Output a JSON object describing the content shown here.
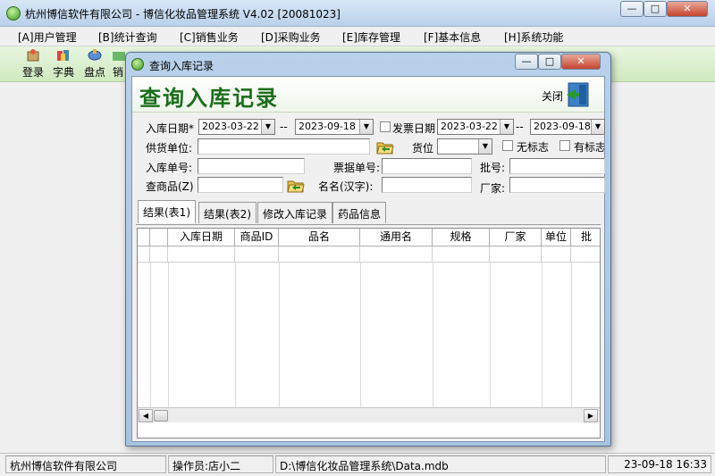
{
  "window": {
    "title": "杭州博信软件有限公司 - 博信化妆品管理系统 V4.02 [20081023]",
    "min_glyph": "—",
    "max_glyph": "□",
    "close_glyph": "✕"
  },
  "menu": [
    "[A]用户管理",
    "[B]统计查询",
    "[C]销售业务",
    "[D]采购业务",
    "[E]库存管理",
    "[F]基本信息",
    "[H]系统功能"
  ],
  "toolbar": [
    {
      "label": "登录",
      "icon": "login-icon"
    },
    {
      "label": "字典",
      "icon": "dictionary-icon"
    },
    {
      "label": "盘点",
      "icon": "inventory-icon"
    },
    {
      "label": "销",
      "icon": "sales-icon"
    }
  ],
  "dialog": {
    "title": "查询入库记录",
    "banner": "查询入库记录",
    "close_label": "关闭",
    "min_glyph": "—",
    "max_glyph": "□",
    "close_glyph": "✕",
    "form": {
      "inbound_date_label": "入库日期*",
      "inbound_date_from": "2023-03-22",
      "inbound_date_to": "2023-09-18",
      "range_sep": "--",
      "invoice_date_label": "发票日期",
      "invoice_date_from": "2023-03-22",
      "invoice_date_to": "2023-09-18",
      "supplier_label": "供货单位:",
      "supplier_value": "",
      "location_label": "货位",
      "location_value": "",
      "no_mark_label": "无标志",
      "has_mark_label": "有标志",
      "inbound_no_label": "入库单号:",
      "inbound_no_value": "",
      "ticket_no_label": "票据单号:",
      "ticket_no_value": "",
      "batch_no_label": "批号:",
      "batch_no_value": "",
      "product_search_label": "查商品(Z)",
      "product_search_value": "",
      "name_label": "名名(汉字):",
      "name_value": "",
      "manufacturer_label": "厂家:",
      "manufacturer_value": ""
    },
    "tabs": [
      "结果(表1)",
      "结果(表2)",
      "修改入库记录",
      "药品信息"
    ],
    "active_tab": 0,
    "grid": {
      "columns": [
        "",
        "",
        "入库日期",
        "商品ID",
        "品名",
        "通用名",
        "规格",
        "厂家",
        "单位",
        "批"
      ],
      "rows": []
    }
  },
  "status": {
    "company": "杭州博信软件有限公司",
    "operator": "操作员:店小二",
    "db_path": "D:\\博信化妆品管理系统\\Data.mdb",
    "datetime": "23-09-18 16:33"
  }
}
